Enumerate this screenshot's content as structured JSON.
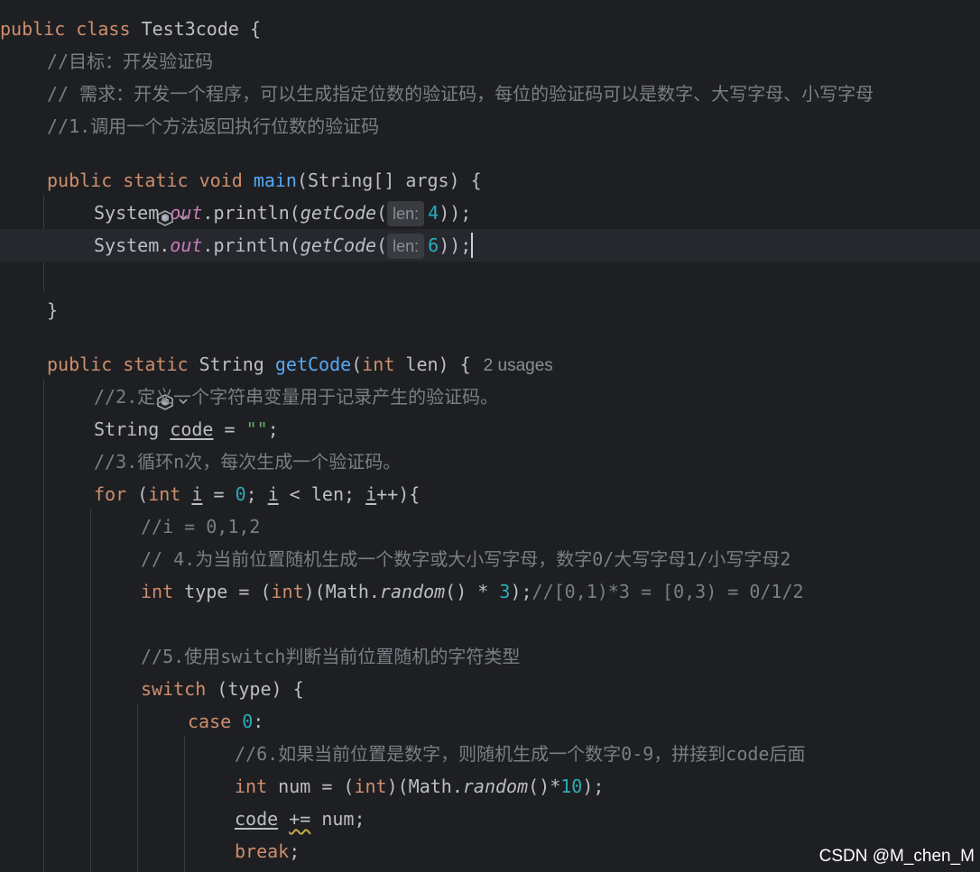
{
  "editor": {
    "class_decl": {
      "kw_public": "public",
      "kw_class": "class",
      "name": "Test3code",
      "brace": " {"
    },
    "comment1": "//目标：开发验证码",
    "comment2": "// 需求：开发一个程序，可以生成指定位数的验证码，每位的验证码可以是数字、大写字母、小写字母",
    "comment3": "//1.调用一个方法返回执行位数的验证码",
    "main_decl": {
      "kw1": "public",
      "kw2": "static",
      "kw3": "void",
      "name": "main",
      "params": "(String[] args) {"
    },
    "call1": {
      "prefix": "System.",
      "field": "out",
      "mid": ".println(",
      "fn": "getCode",
      "open": "(",
      "hint": "len:",
      "arg": "4",
      "close": "));"
    },
    "call2": {
      "prefix": "System.",
      "field": "out",
      "mid": ".println(",
      "fn": "getCode",
      "open": "(",
      "hint": "len:",
      "arg": "6",
      "close": "));"
    },
    "close_brace": "}",
    "getcode_decl": {
      "kw1": "public",
      "kw2": "static",
      "type": "String",
      "name": "getCode",
      "open": "(",
      "kw_int": "int",
      "params": " len) {",
      "usages": "2 usages"
    },
    "comment4": "//2.定义一个字符串变量用于记录产生的验证码。",
    "code_init": {
      "type": "String",
      "var": "code",
      "eq": " = ",
      "str": "\"\"",
      "semi": ";"
    },
    "comment5": "//3.循环n次，每次生成一个验证码。",
    "for_line": {
      "kw_for": "for",
      "open": " (",
      "kw_int": "int",
      "i1": "i",
      "eq": " = ",
      "zero": "0",
      "semi1": "; ",
      "i2": "i",
      "cond": " < len; ",
      "i3": "i",
      "tail": "++){"
    },
    "comment6": "//i = 0,1,2",
    "comment7": "// 4.为当前位置随机生成一个数字或大小写字母，数字0/大写字母1/小写字母2",
    "type_line": {
      "kw_int": "int",
      "mid": " type = (",
      "kw_int2": "int",
      "math": ")(Math.",
      "random": "random",
      "mul": "() * ",
      "three": "3",
      "end": ");",
      "comment": "//[0,1)*3 = [0,3) = 0/1/2"
    },
    "comment8": "//5.使用switch判断当前位置随机的字符类型",
    "switch_line": {
      "kw": "switch",
      "rest": " (type) {"
    },
    "case_line": {
      "kw": "case",
      "sp": " ",
      "num": "0",
      "colon": ":"
    },
    "comment9": "//6.如果当前位置是数字，则随机生成一个数字0-9，拼接到code后面",
    "num_line": {
      "kw_int": "int",
      "mid": " num = (",
      "kw_int2": "int",
      "math": ")(Math.",
      "random": "random",
      "mul": "()*",
      "ten": "10",
      "end": ");"
    },
    "append_line": {
      "var": "code",
      "sp": " ",
      "op": "+=",
      "rest": " num;"
    },
    "break_line": {
      "kw": "break",
      "semi": ";"
    }
  },
  "icons": {
    "ai_icon": "ai-assistant-icon",
    "chevron": "chevron-down-icon"
  },
  "colors": {
    "background": "#1e1f22",
    "keyword": "#cf8e6d",
    "function": "#56a8f5",
    "number": "#2aacb8",
    "comment": "#7a7e85",
    "field": "#c77dbb"
  },
  "watermark": "CSDN @M_chen_M"
}
